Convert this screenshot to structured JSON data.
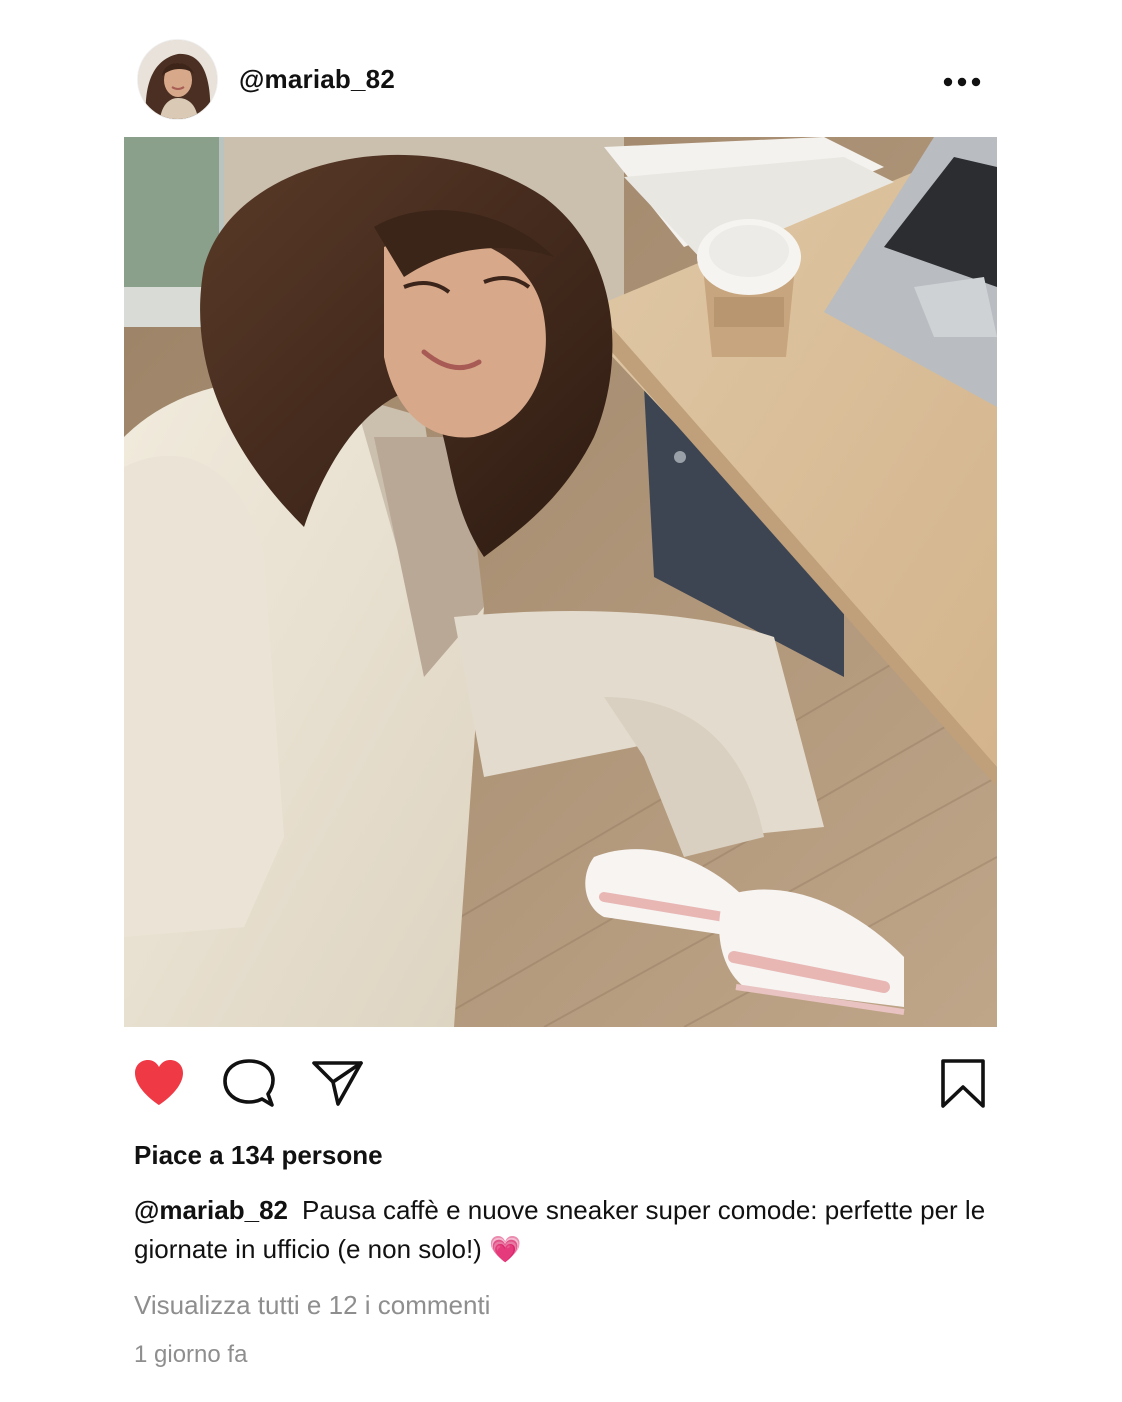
{
  "post": {
    "username": "@mariab_82",
    "likes_text": "Piace a 134 persone",
    "caption_handle": "@mariab_82",
    "caption_text": "Pausa caffè e nuove sneaker super comode: perfette per le giornate in ufficio (e non solo!)",
    "caption_emoji": "💗",
    "view_comments": "Visualizza tutti e 12 i commenti",
    "timestamp": "1 giorno fa",
    "liked": true
  },
  "icons": {
    "more": "more-horizontal-icon",
    "like": "heart-filled-icon",
    "comment": "comment-bubble-icon",
    "share": "paper-plane-icon",
    "save": "bookmark-icon"
  },
  "colors": {
    "like": "#ef3a45",
    "secondary_text": "#8e8e8e",
    "primary_text": "#111111"
  }
}
